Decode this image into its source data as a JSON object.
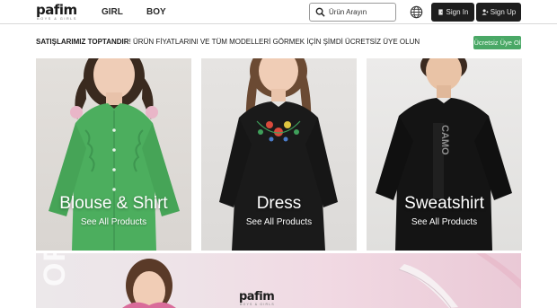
{
  "header": {
    "logo_text": "pafim",
    "logo_sub": "BOYS & GIRLS",
    "nav": [
      {
        "label": "GIRL"
      },
      {
        "label": "BOY"
      }
    ],
    "search": {
      "placeholder": "Ürün Arayın",
      "icon": "search-icon"
    },
    "language_icon": "globe-icon",
    "sign_in": "Sign In",
    "sign_up": "Sign Up"
  },
  "promo": {
    "bold": "SATIŞLARIMIZ TOPTANDIR",
    "text": "! ÜRÜN FİYATLARINI VE TÜM MODELLERİ GÖRMEK İÇİN ŞİMDİ ÜCRETSİZ ÜYE OLUN",
    "cta": "Ücretsiz Üye Ol",
    "cta_color": "#4aa866"
  },
  "categories": [
    {
      "title": "Blouse & Shirt",
      "subtitle": "See All Products",
      "garment_color": "#4cae5e"
    },
    {
      "title": "Dress",
      "subtitle": "See All Products",
      "garment_color": "#1a1a1a"
    },
    {
      "title": "Sweatshirt",
      "subtitle": "See All Products",
      "garment_color": "#141414"
    }
  ],
  "banner": {
    "background_word": "ORT",
    "logo_text": "pafim",
    "logo_sub": "BOYS & GIRLS"
  }
}
